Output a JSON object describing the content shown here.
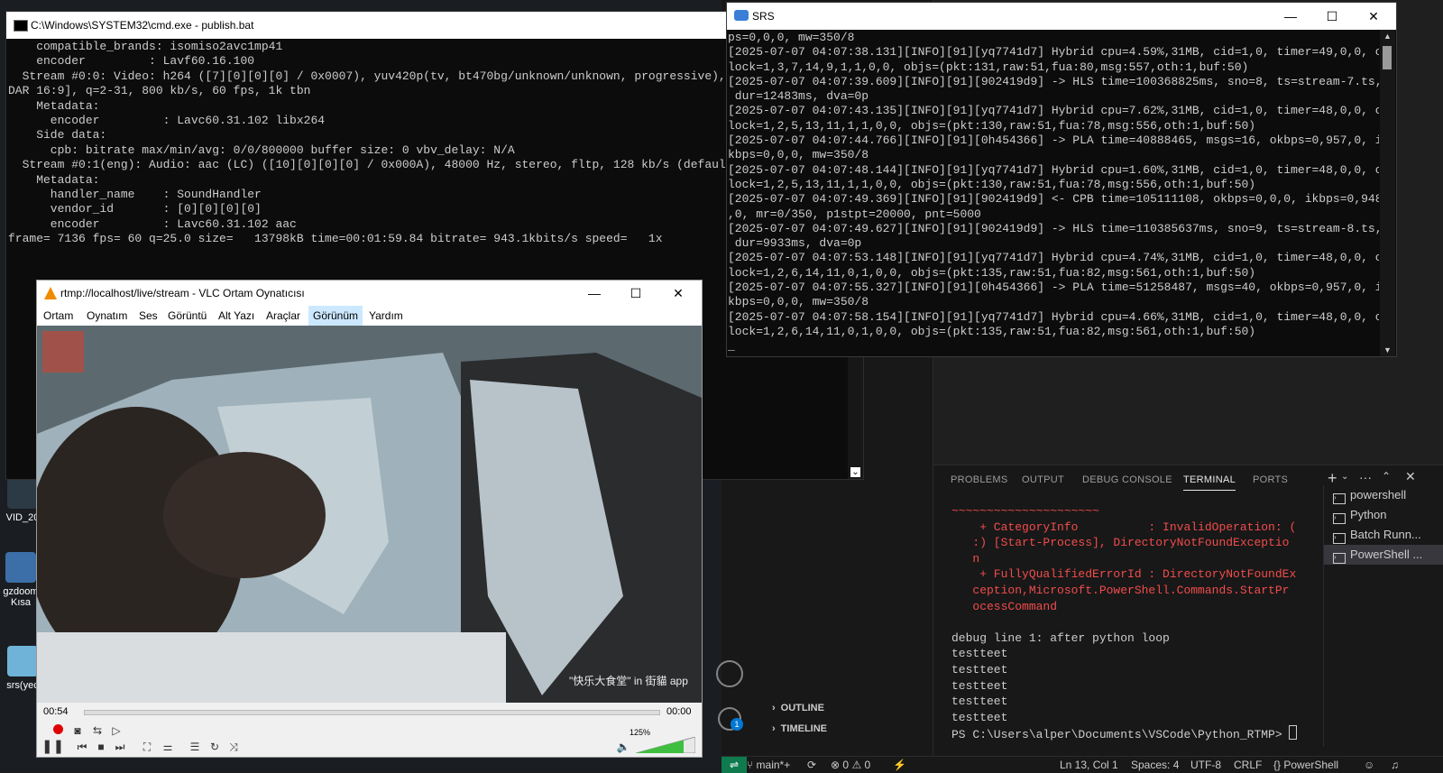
{
  "desktop": {
    "icons": [
      {
        "label": "VID_20"
      },
      {
        "label": "gzdoom\nKısa"
      },
      {
        "label": "srs(yec"
      }
    ]
  },
  "cmd": {
    "title": "C:\\Windows\\SYSTEM32\\cmd.exe - publish.bat",
    "lines": [
      "    compatible_brands: isomiso2avc1mp41",
      "    encoder         : Lavf60.16.100",
      "  Stream #0:0: Video: h264 ([7][0][0][0] / 0x0007), yuv420p(tv, bt470bg/unknown/unknown, progressive), 1",
      "DAR 16:9], q=2-31, 800 kb/s, 60 fps, 1k tbn",
      "    Metadata:",
      "      encoder         : Lavc60.31.102 libx264",
      "    Side data:",
      "      cpb: bitrate max/min/avg: 0/0/800000 buffer size: 0 vbv_delay: N/A",
      "  Stream #0:1(eng): Audio: aac (LC) ([10][0][0][0] / 0x000A), 48000 Hz, stereo, fltp, 128 kb/s (default)",
      "    Metadata:",
      "      handler_name    : SoundHandler",
      "      vendor_id       : [0][0][0][0]",
      "      encoder         : Lavc60.31.102 aac",
      "frame= 7136 fps= 60 q=25.0 size=   13798kB time=00:01:59.84 bitrate= 943.1kbits/s speed=   1x"
    ]
  },
  "srs": {
    "title": "SRS",
    "lines": [
      "ps=0,0,0, mw=350/8",
      "[2025-07-07 04:07:38.131][INFO][91][yq7741d7] Hybrid cpu=4.59%,31MB, cid=1,0, timer=49,0,0, c",
      "lock=1,3,7,14,9,1,1,0,0, objs=(pkt:131,raw:51,fua:80,msg:557,oth:1,buf:50)",
      "[2025-07-07 04:07:39.609][INFO][91][902419d9] -> HLS time=100368825ms, sno=8, ts=stream-7.ts,",
      " dur=12483ms, dva=0p",
      "[2025-07-07 04:07:43.135][INFO][91][yq7741d7] Hybrid cpu=7.62%,31MB, cid=1,0, timer=48,0,0, c",
      "lock=1,2,5,13,11,1,1,0,0, objs=(pkt:130,raw:51,fua:78,msg:556,oth:1,buf:50)",
      "[2025-07-07 04:07:44.766][INFO][91][0h454366] -> PLA time=40888465, msgs=16, okbps=0,957,0, i",
      "kbps=0,0,0, mw=350/8",
      "[2025-07-07 04:07:48.144][INFO][91][yq7741d7] Hybrid cpu=1.60%,31MB, cid=1,0, timer=48,0,0, c",
      "lock=1,2,5,13,11,1,1,0,0, objs=(pkt:130,raw:51,fua:78,msg:556,oth:1,buf:50)",
      "[2025-07-07 04:07:49.369][INFO][91][902419d9] <- CPB time=105111108, okbps=0,0,0, ikbps=0,948",
      ",0, mr=0/350, p1stpt=20000, pnt=5000",
      "[2025-07-07 04:07:49.627][INFO][91][902419d9] -> HLS time=110385637ms, sno=9, ts=stream-8.ts,",
      " dur=9933ms, dva=0p",
      "[2025-07-07 04:07:53.148][INFO][91][yq7741d7] Hybrid cpu=4.74%,31MB, cid=1,0, timer=48,0,0, c",
      "lock=1,2,6,14,11,0,1,0,0, objs=(pkt:135,raw:51,fua:82,msg:561,oth:1,buf:50)",
      "[2025-07-07 04:07:55.327][INFO][91][0h454366] -> PLA time=51258487, msgs=40, okbps=0,957,0, i",
      "kbps=0,0,0, mw=350/8",
      "[2025-07-07 04:07:58.154][INFO][91][yq7741d7] Hybrid cpu=4.66%,31MB, cid=1,0, timer=48,0,0, c",
      "lock=1,2,6,14,11,0,1,0,0, objs=(pkt:135,raw:51,fua:82,msg:561,oth:1,buf:50)",
      "_"
    ]
  },
  "vlc": {
    "title": "rtmp://localhost/live/stream - VLC Ortam Oynatıcısı",
    "menu": [
      "Ortam",
      "Oynatım",
      "Ses",
      "Görüntü",
      "Alt Yazı",
      "Araçlar",
      "Görünüm",
      "Yardım"
    ],
    "watermark": "\"快乐大食堂\" in 街貓 app",
    "time_elapsed": "00:54",
    "time_total": "00:00",
    "volume": "125%"
  },
  "vscode": {
    "outline_label": "OUTLINE",
    "timeline_label": "TIMELINE",
    "panel_tabs": [
      "PROBLEMS",
      "OUTPUT",
      "DEBUG CONSOLE",
      "TERMINAL",
      "PORTS"
    ],
    "active_tab": "TERMINAL",
    "terminal_error_lines": [
      "~~~~~~~~~~~~~~~~~~~~~",
      "    + CategoryInfo          : InvalidOperation: (",
      "   :) [Start-Process], DirectoryNotFoundExceptio",
      "   n",
      "    + FullyQualifiedErrorId : DirectoryNotFoundEx",
      "   ception,Microsoft.PowerShell.Commands.StartPr",
      "   ocessCommand"
    ],
    "terminal_output_lines": [
      "",
      "debug line 1: after python loop",
      "testteet",
      "testteet",
      "testteet",
      "testteet",
      "testteet",
      "PS C:\\Users\\alper\\Documents\\VSCode\\Python_RTMP> "
    ],
    "terminals": [
      {
        "label": "powershell",
        "selected": false
      },
      {
        "label": "Python",
        "selected": false
      },
      {
        "label": "Batch Runn...",
        "selected": false
      },
      {
        "label": "PowerShell ...",
        "selected": true
      }
    ],
    "status": {
      "branch": "main*+",
      "errors": "0",
      "warnings": "0",
      "position": "Ln 13, Col 1",
      "spaces": "Spaces: 4",
      "encoding": "UTF-8",
      "eol": "CRLF",
      "language": "PowerShell"
    },
    "badge": "1"
  }
}
